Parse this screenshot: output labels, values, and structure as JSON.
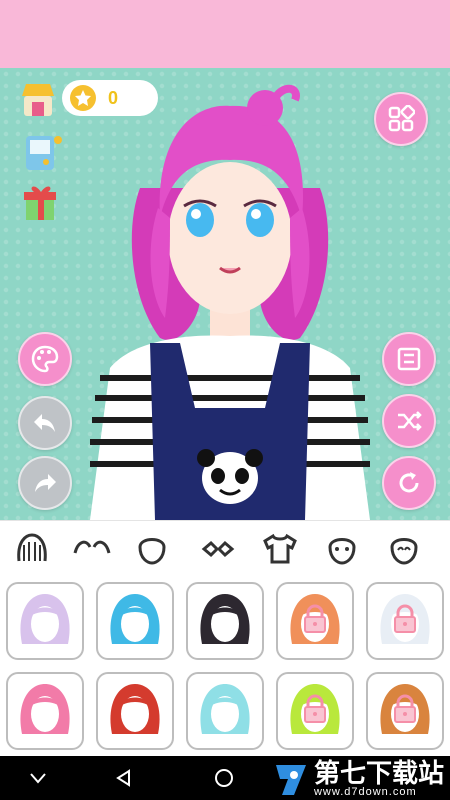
{
  "coins": {
    "value": "0"
  },
  "toolbar_left": [
    "shop-icon",
    "game-console-icon",
    "gift-icon"
  ],
  "side_left": [
    "palette-icon",
    "undo-icon",
    "redo-icon"
  ],
  "side_right": [
    "grid-menu-icon",
    "save-icon",
    "shuffle-icon",
    "reset-icon"
  ],
  "categories": [
    "hair",
    "eyebrows",
    "face",
    "glasses",
    "clothes",
    "head",
    "expression"
  ],
  "hair_options": [
    {
      "color": "#d8c2ec",
      "locked": false
    },
    {
      "color": "#3fb9e6",
      "locked": false
    },
    {
      "color": "#2d2830",
      "locked": false
    },
    {
      "color": "#f0905a",
      "locked": true
    },
    {
      "color": "#e8eef5",
      "locked": true
    },
    {
      "color": "#f27ba8",
      "locked": false
    },
    {
      "color": "#d43b2e",
      "locked": false
    },
    {
      "color": "#8fdfe6",
      "locked": false
    },
    {
      "color": "#b9e83c",
      "locked": true
    },
    {
      "color": "#d9843e",
      "locked": true
    }
  ],
  "colors": {
    "accent": "#f58fcb",
    "background": "#8fd6c6",
    "top_bar": "#f9b8d8"
  },
  "watermark": {
    "title": "第七下载站",
    "url": "www.d7down.com"
  }
}
